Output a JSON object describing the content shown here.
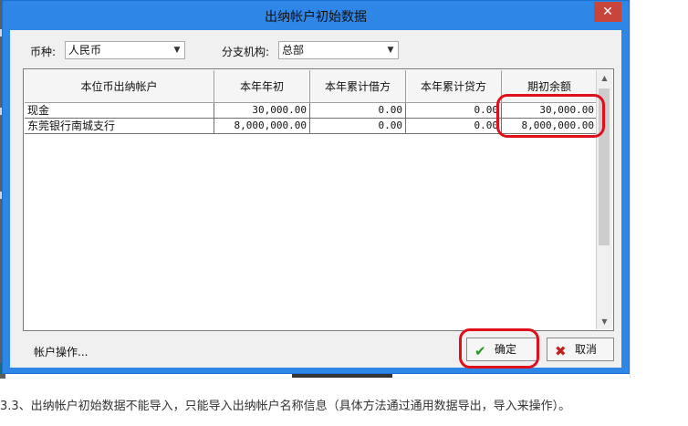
{
  "window": {
    "title": "出纳帐户初始数据",
    "close_glyph": "✕"
  },
  "filters": {
    "currency_label": "币种:",
    "currency_value": "人民币",
    "branch_label": "分支机构:",
    "branch_value": "总部"
  },
  "table": {
    "columns": [
      "本位币出纳帐户",
      "本年年初",
      "本年累计借方",
      "本年累计贷方",
      "期初余额"
    ],
    "rows": [
      [
        "现金",
        "30,000.00",
        "0.00",
        "0.00",
        "30,000.00"
      ],
      [
        "东莞银行南城支行",
        "8,000,000.00",
        "0.00",
        "0.00",
        "8,000,000.00"
      ]
    ]
  },
  "footer": {
    "account_ops_label": "帐户操作...",
    "ok_label": "确定",
    "cancel_label": "取消"
  },
  "caption": "3.3、出纳帐户初始数据不能导入，只能导入出纳帐户名称信息（具体方法通过通用数据导出，导入来操作）。",
  "colors": {
    "titlebar": "#2e86e6",
    "close": "#c7453b",
    "highlight": "#e0101a",
    "ok_icon": "#1f9a1f",
    "cancel_icon": "#c0201a"
  },
  "icons": {
    "ok": "checkmark-icon",
    "cancel": "x-icon"
  }
}
